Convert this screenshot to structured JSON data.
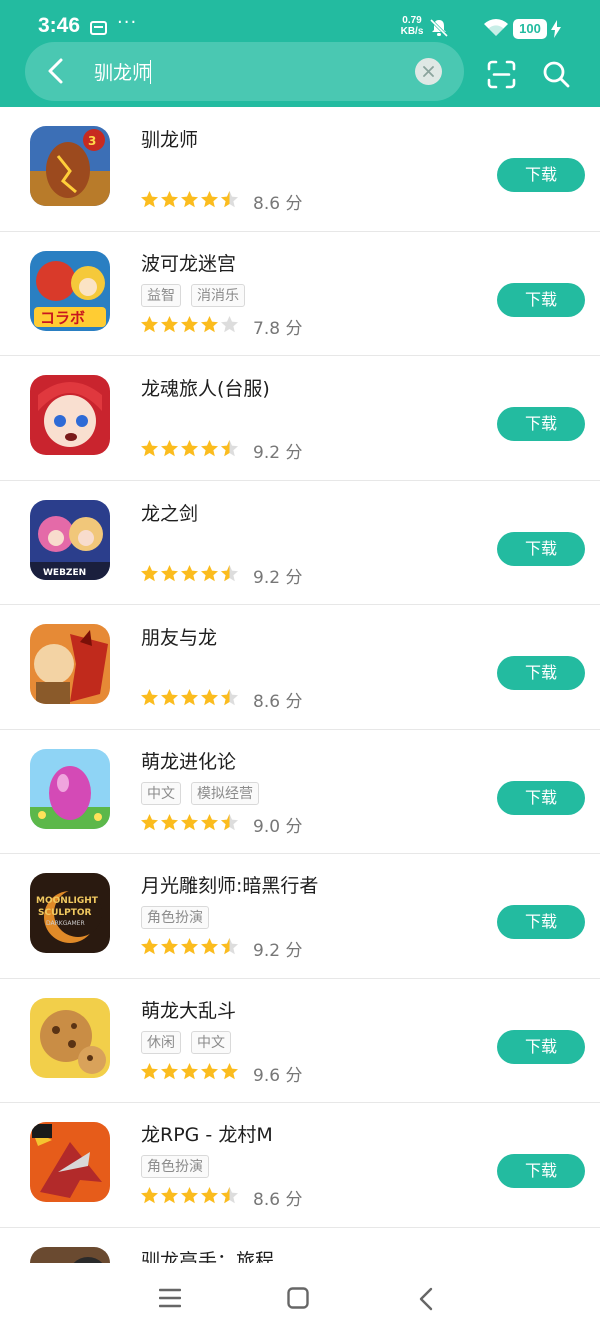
{
  "status_bar": {
    "time": "3:46",
    "dots": "···",
    "speed_value": "0.79",
    "speed_unit": "KB/s",
    "battery": "100"
  },
  "search": {
    "query": "驯龙师"
  },
  "colors": {
    "accent": "#23bba0",
    "star": "#fbbc1e",
    "star_empty": "#dddddd"
  },
  "apps": [
    {
      "name": "驯龙师",
      "tags": [],
      "rating": 4.5,
      "score": "8.6 分",
      "download_label": "下载",
      "icon": "dragon-egg-icon"
    },
    {
      "name": "波可龙迷宫",
      "tags": [
        "益智",
        "消消乐"
      ],
      "rating": 4,
      "score": "7.8 分",
      "download_label": "下载",
      "icon": "red-dragon-collab-icon"
    },
    {
      "name": "龙魂旅人(台服)",
      "tags": [],
      "rating": 4.5,
      "score": "9.2 分",
      "download_label": "下载",
      "icon": "anime-girl-icon"
    },
    {
      "name": "龙之剑",
      "tags": [],
      "rating": 4.5,
      "score": "9.2 分",
      "download_label": "下载",
      "icon": "webzen-heroes-icon"
    },
    {
      "name": "朋友与龙",
      "tags": [],
      "rating": 4.5,
      "score": "8.6 分",
      "download_label": "下载",
      "icon": "red-dragon-warrior-icon"
    },
    {
      "name": "萌龙进化论",
      "tags": [
        "中文",
        "模拟经营"
      ],
      "rating": 4.5,
      "score": "9.0 分",
      "download_label": "下载",
      "icon": "pink-egg-icon"
    },
    {
      "name": "月光雕刻师:暗黑行者",
      "tags": [
        "角色扮演"
      ],
      "rating": 4.5,
      "score": "9.2 分",
      "download_label": "下载",
      "icon": "moonlight-sculptor-icon"
    },
    {
      "name": "萌龙大乱斗",
      "tags": [
        "休闲",
        "中文"
      ],
      "rating": 5,
      "score": "9.6 分",
      "download_label": "下载",
      "icon": "cookie-dragon-icon"
    },
    {
      "name": "龙RPG - 龙村M",
      "tags": [
        "角色扮演"
      ],
      "rating": 4.5,
      "score": "8.6 分",
      "download_label": "下载",
      "icon": "mecha-dragon-icon"
    },
    {
      "name": "驯龙高手：旅程",
      "tags": [],
      "rating": 0,
      "score": "",
      "download_label": "",
      "icon": "dragon-rider-icon"
    }
  ]
}
